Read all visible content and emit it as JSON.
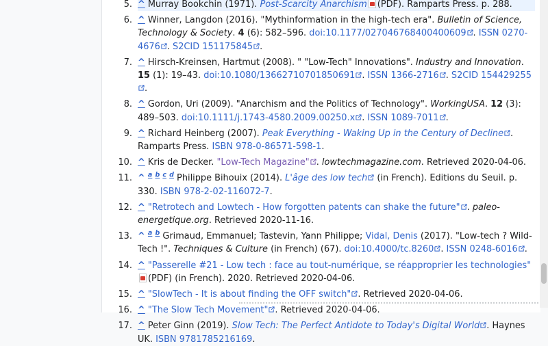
{
  "references": [
    {
      "n": "5.",
      "author": "Murray Bookchin (1971).",
      "title": "Post-Scarcity Anarchism",
      "format": "(PDF).",
      "rest": "Ramparts Press. p. 288."
    },
    {
      "n": "6.",
      "author": "Winner, Langdon (2016). \"Mythinformation in the high-tech era\".",
      "journal": "Bulletin of Science, Technology & Society",
      "vol": "4",
      "issue": "(6): 582–596.",
      "doi_label": "doi:",
      "doi": "10.1177/027046768400400609",
      "issn_label": "ISSN",
      "issn": "0270-4676",
      "s2cid_label": "S2CID",
      "s2cid": "151175845"
    },
    {
      "n": "7.",
      "author": "Hirsch-Kreinsen, Hartmut (2008). \" \"Low-Tech\" Innovations\".",
      "journal": "Industry and Innovation",
      "vol": "15",
      "issue": "(1): 19–43.",
      "doi_label": "doi:",
      "doi": "10.1080/13662710701850691",
      "issn_label": "ISSN",
      "issn": "1366-2716",
      "s2cid_label": "S2CID",
      "s2cid": "154429255"
    },
    {
      "n": "8.",
      "author": "Gordon, Uri (2009). \"Anarchism and the Politics of Technology\".",
      "journal": "WorkingUSA",
      "vol": "12",
      "issue": "(3): 489–503.",
      "doi_label": "doi:",
      "doi": "10.1111/j.1743-4580.2009.00250.x",
      "issn_label": "ISSN",
      "issn": "1089-7011"
    },
    {
      "n": "9.",
      "author": "Richard Heinberg (2007).",
      "title": "Peak Everything - Waking Up in the Century of Decline",
      "rest": "Ramparts Press.",
      "isbn_label": "ISBN",
      "isbn": "978-0-86571-598-1"
    },
    {
      "n": "10.",
      "author": "Kris de Decker.",
      "title": "\"Low-Tech Magazine\"",
      "site": "lowtechmagazine.com",
      "rest": "Retrieved 2020-04-06."
    },
    {
      "n": "11.",
      "letters": [
        "a",
        "b",
        "c",
        "d"
      ],
      "author": "Philippe Bihouix (2014).",
      "title": "L'âge des low tech",
      "rest": "(in French). Editions du Seuil. p. 330.",
      "isbn_label": "ISBN",
      "isbn": "978-2-02-116072-7"
    },
    {
      "n": "12.",
      "title": "\"Retrotech and Lowtech - How forgotten patents can shake the future\"",
      "site": "paleo-energetique.org",
      "rest": "Retrieved 2020-11-16."
    },
    {
      "n": "13.",
      "letters": [
        "a",
        "b"
      ],
      "author": "Grimaud, Emmanuel; Tastevin, Yann Philippe;",
      "author_link": "Vidal, Denis",
      "year": "(2017). \"Low-tech ? Wild-Tech !\".",
      "journal": "Techniques & Culture",
      "issue": "(in French) (67).",
      "doi_label": "doi:",
      "doi": "10.4000/tc.8260",
      "issn_label": "ISSN",
      "issn": "0248-6016"
    },
    {
      "n": "14.",
      "title": "\"Passerelle #21 - Low tech : face au tout-numérique, se réapproprier les technologies\"",
      "format": "(PDF)",
      "rest": "(in French). 2020. Retrieved 2020-04-06."
    },
    {
      "n": "15.",
      "title": "\"SlowTech - It is about finding the OFF switch\"",
      "rest": "Retrieved 2020-04-06."
    },
    {
      "n": "16.",
      "title": "\"The Slow Tech Movement\"",
      "rest": "Retrieved 2020-04-06."
    },
    {
      "n": "17.",
      "author": "Peter Ginn (2019).",
      "title": "Slow Tech: The Perfect Antidote to Today's Digital World",
      "rest": "Haynes UK.",
      "isbn_label": "ISBN",
      "isbn": "9781785216169"
    }
  ],
  "caret": "^",
  "icons": {
    "external": "external-link-icon",
    "pdf": "pdf-icon"
  },
  "colors": {
    "link": "#3366cc",
    "visited": "#795cb2",
    "highlight": "#eaf3ff"
  }
}
